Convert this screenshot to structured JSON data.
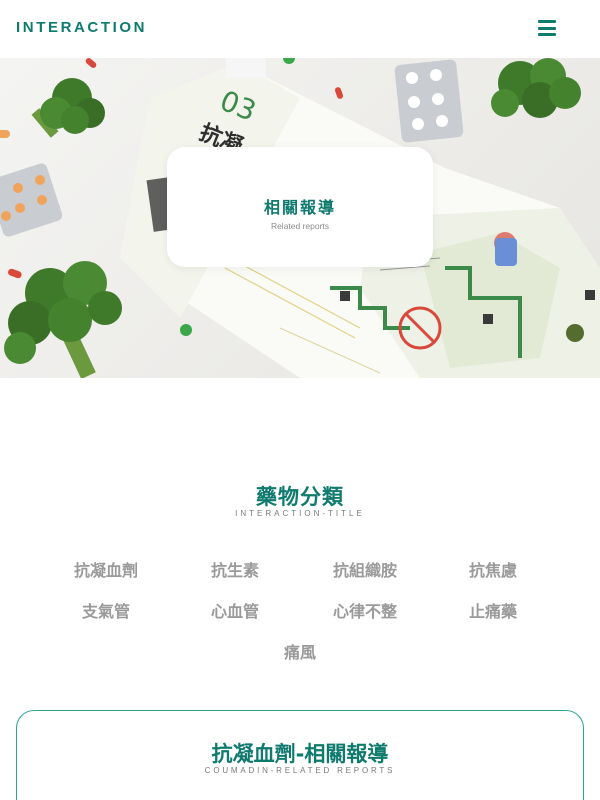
{
  "header": {
    "brand": "INTERACTION",
    "menu_icon": "hamburger-menu-icon"
  },
  "hero": {
    "title": "相關報導",
    "subtitle": "Related reports",
    "brochure_number": "03",
    "brochure_heading": "抗凝",
    "colors": {
      "accent": "#0f7a6e",
      "green": "#3c8a4a",
      "pill_red": "#d9483b"
    }
  },
  "categories": {
    "title": "藥物分類",
    "subtitle": "INTERACTION-TITLE",
    "items": [
      "抗凝血劑",
      "抗生素",
      "抗組織胺",
      "抗焦慮",
      "支氣管",
      "心血管",
      "心律不整",
      "止痛藥",
      "痛風"
    ]
  },
  "related": {
    "title": "抗凝血劑-相關報導",
    "subtitle": "COUMADIN-RELATED REPORTS"
  },
  "colors": {
    "accent": "#0f7a6e",
    "border": "#2aa395",
    "muted_text": "#9a9a9a"
  }
}
